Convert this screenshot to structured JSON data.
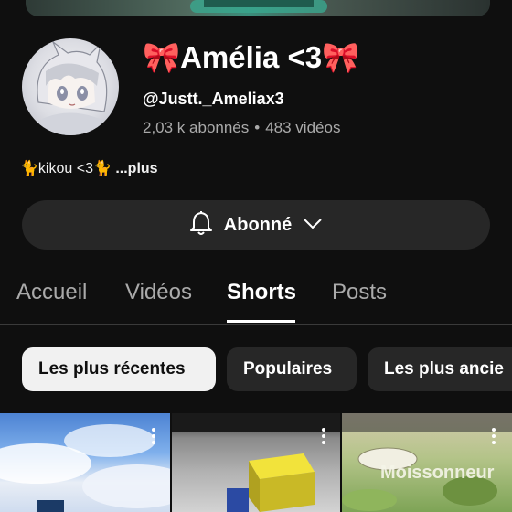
{
  "channel": {
    "name": "🎀Amélia <3🎀",
    "handle": "@Justt._Ameliax3",
    "subscribers": "2,03 k abonnés",
    "separator": "•",
    "videos": "483 vidéos",
    "description": "🐈kikou <3🐈",
    "more_label": "...plus"
  },
  "subscribe": {
    "label": "Abonné",
    "bell_icon": "bell-icon",
    "chevron_icon": "chevron-down-icon"
  },
  "tabs": [
    {
      "label": "Accueil"
    },
    {
      "label": "Vidéos"
    },
    {
      "label": "Shorts",
      "active": true
    },
    {
      "label": "Posts"
    }
  ],
  "filters": [
    {
      "label": "Les plus récentes",
      "selected": true
    },
    {
      "label": "Populaires"
    },
    {
      "label": "Les plus ancie"
    }
  ],
  "shorts": [
    {
      "overlay": ""
    },
    {
      "overlay": ""
    },
    {
      "overlay": "Moissonneur"
    }
  ],
  "colors": {
    "background": "#0f0f0f",
    "chip": "#272727",
    "chip_selected": "#f1f1f1",
    "muted_text": "#aaaaaa"
  }
}
